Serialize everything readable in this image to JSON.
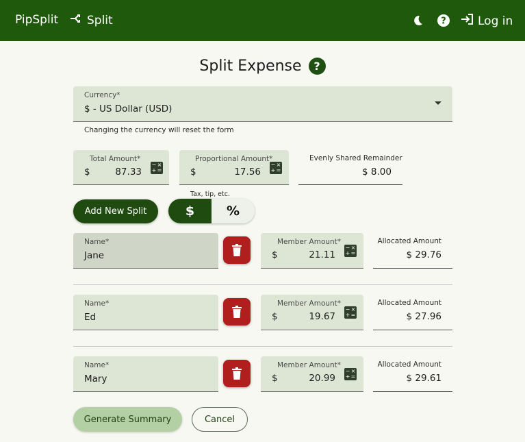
{
  "appbar": {
    "brand": "PipSplit",
    "nav_split": "Split",
    "login": "Log in",
    "icons": [
      "split-icon",
      "moon-icon",
      "help-icon",
      "login-icon"
    ]
  },
  "page": {
    "title": "Split Expense"
  },
  "currency": {
    "label": "Currency*",
    "value": "$ - US Dollar (USD)",
    "helper": "Changing the currency will reset the form"
  },
  "totals": {
    "total_label": "Total Amount*",
    "total_prefix": "$",
    "total_value": "87.33",
    "prop_label": "Proportional Amount*",
    "prop_prefix": "$",
    "prop_value": "17.56",
    "prop_caption": "Tax, tip, etc.",
    "remainder_label": "Evenly Shared Remainder",
    "remainder_value": "$ 8.00"
  },
  "actions": {
    "add_split": "Add New Split",
    "toggle_dollar": "$",
    "toggle_percent": "%",
    "generate": "Generate Summary",
    "cancel": "Cancel"
  },
  "splits": [
    {
      "name_label": "Name*",
      "name": "Jane",
      "member_label": "Member Amount*",
      "prefix": "$",
      "member_amount": "21.11",
      "alloc_label": "Allocated Amount",
      "alloc_value": "$ 29.76"
    },
    {
      "name_label": "Name*",
      "name": "Ed",
      "member_label": "Member Amount*",
      "prefix": "$",
      "member_amount": "19.67",
      "alloc_label": "Allocated Amount",
      "alloc_value": "$ 27.96"
    },
    {
      "name_label": "Name*",
      "name": "Mary",
      "member_label": "Member Amount*",
      "prefix": "$",
      "member_amount": "20.99",
      "alloc_label": "Allocated Amount",
      "alloc_value": "$ 29.61"
    }
  ],
  "colors": {
    "appbar": "#1f5a0c",
    "primary": "#1f4a10",
    "field_bg": "#dde5d5",
    "delete": "#b01e1e",
    "page_bg": "#f6f8f1"
  }
}
